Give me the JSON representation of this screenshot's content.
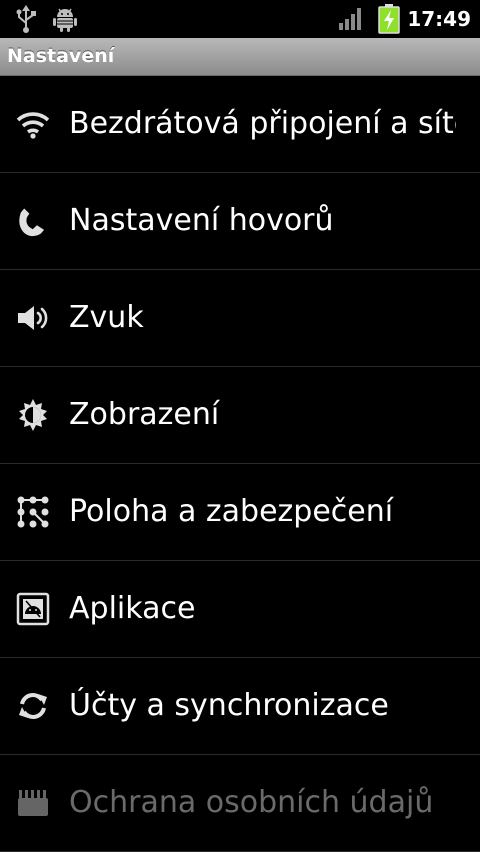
{
  "status_bar": {
    "time": "17:49",
    "icons": [
      "usb-icon",
      "android-debug-icon",
      "signal-icon",
      "battery-charging-icon"
    ],
    "battery_color": "#8ee02b"
  },
  "title_bar": {
    "title": "Nastavení"
  },
  "settings": {
    "items": [
      {
        "label": "Bezdrátová připojení a sítě",
        "icon": "wifi-icon"
      },
      {
        "label": "Nastavení hovorů",
        "icon": "phone-icon"
      },
      {
        "label": "Zvuk",
        "icon": "speaker-icon"
      },
      {
        "label": "Zobrazení",
        "icon": "brightness-icon"
      },
      {
        "label": "Poloha a zabezpečení",
        "icon": "pattern-lock-icon"
      },
      {
        "label": "Aplikace",
        "icon": "applications-icon"
      },
      {
        "label": "Účty a synchronizace",
        "icon": "sync-icon"
      },
      {
        "label": "Ochrana osobních údajů",
        "icon": "privacy-icon"
      }
    ]
  }
}
